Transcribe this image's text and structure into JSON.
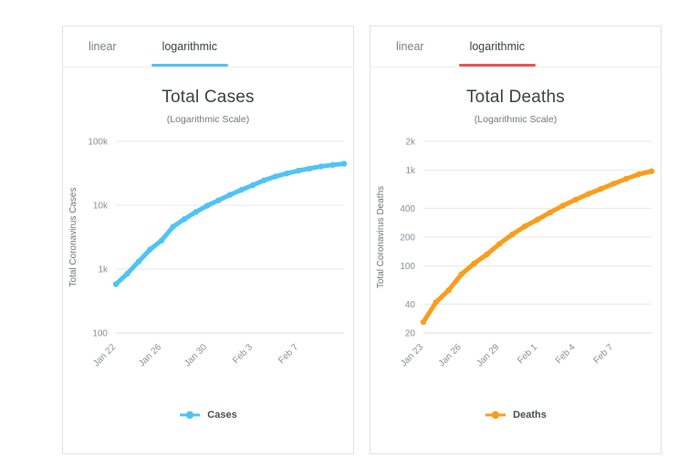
{
  "cards": {
    "cases": {
      "tabs": [
        {
          "label": "linear",
          "active": false
        },
        {
          "label": "logarithmic",
          "active": true
        }
      ],
      "accent": "#4fc3f7",
      "title": "Total Cases",
      "subtitle": "(Logarithmic Scale)",
      "legend_label": "Cases"
    },
    "deaths": {
      "tabs": [
        {
          "label": "linear",
          "active": false
        },
        {
          "label": "logarithmic",
          "active": true
        }
      ],
      "accent": "#ef5350",
      "title": "Total Deaths",
      "subtitle": "(Logarithmic Scale)",
      "legend_label": "Deaths"
    }
  },
  "chart_data": [
    {
      "type": "line",
      "id": "cases",
      "title": "Total Cases",
      "subtitle": "(Logarithmic Scale)",
      "xlabel": "",
      "ylabel": "Total Coronavirus Cases",
      "scale": "log",
      "series_color": "#4fc3f7",
      "legend": [
        "Cases"
      ],
      "legend_position": "bottom",
      "grid": true,
      "ylim": [
        100,
        100000
      ],
      "yticks": [
        100,
        1000,
        10000,
        100000
      ],
      "ytick_labels": [
        "100",
        "1k",
        "10k",
        "100k"
      ],
      "xticks": [
        "Jan 22",
        "Jan 26",
        "Jan 30",
        "Feb 3",
        "Feb 7"
      ],
      "x": [
        "Jan 22",
        "Jan 23",
        "Jan 24",
        "Jan 25",
        "Jan 26",
        "Jan 27",
        "Jan 28",
        "Jan 29",
        "Jan 30",
        "Jan 31",
        "Feb 1",
        "Feb 2",
        "Feb 3",
        "Feb 4",
        "Feb 5",
        "Feb 6",
        "Feb 7",
        "Feb 8",
        "Feb 9",
        "Feb 10",
        "Feb 11"
      ],
      "values": [
        580,
        845,
        1315,
        2030,
        2800,
        4580,
        6060,
        7820,
        9820,
        11950,
        14550,
        17380,
        20620,
        24550,
        28270,
        31480,
        34810,
        37560,
        40550,
        42750,
        44730
      ]
    },
    {
      "type": "line",
      "id": "deaths",
      "title": "Total Deaths",
      "subtitle": "(Logarithmic Scale)",
      "xlabel": "",
      "ylabel": "Total Coronavirus Deaths",
      "scale": "log",
      "series_color": "#f99d1c",
      "legend": [
        "Deaths"
      ],
      "legend_position": "bottom",
      "grid": true,
      "ylim": [
        20,
        2000
      ],
      "yticks": [
        20,
        40,
        100,
        200,
        400,
        1000,
        2000
      ],
      "ytick_labels": [
        "20",
        "40",
        "100",
        "200",
        "400",
        "1k",
        "2k"
      ],
      "xticks": [
        "Jan 23",
        "Jan 26",
        "Jan 29",
        "Feb 1",
        "Feb 4",
        "Feb 7"
      ],
      "x": [
        "Jan 23",
        "Jan 24",
        "Jan 25",
        "Jan 26",
        "Jan 27",
        "Jan 28",
        "Jan 29",
        "Jan 30",
        "Jan 31",
        "Feb 1",
        "Feb 2",
        "Feb 3",
        "Feb 4",
        "Feb 5",
        "Feb 6",
        "Feb 7",
        "Feb 8",
        "Feb 9",
        "Feb 10"
      ],
      "values": [
        26,
        42,
        56,
        82,
        106,
        132,
        170,
        213,
        259,
        305,
        362,
        426,
        492,
        564,
        637,
        723,
        813,
        910,
        975
      ]
    }
  ]
}
